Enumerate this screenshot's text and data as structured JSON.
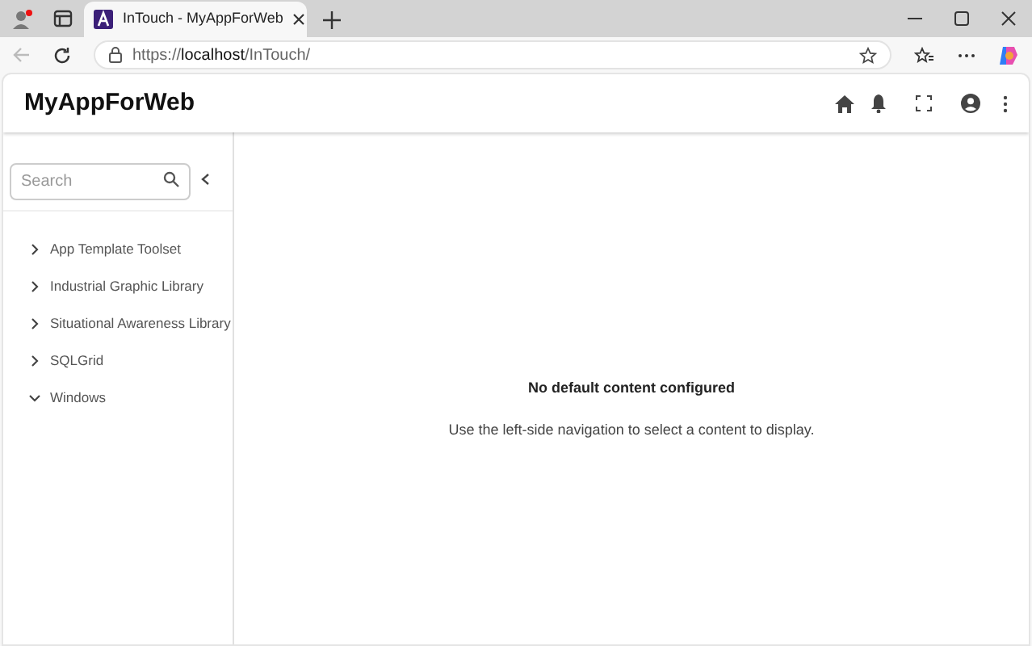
{
  "browser": {
    "tab": {
      "title": "InTouch - MyAppForWeb",
      "selected": true
    },
    "address": {
      "scheme": "https://",
      "host": "localhost",
      "path": "/InTouch/"
    }
  },
  "app": {
    "title": "MyAppForWeb"
  },
  "sidebar": {
    "search": {
      "placeholder": "Search"
    },
    "items": [
      {
        "label": "App Template Toolset",
        "expanded": false
      },
      {
        "label": "Industrial Graphic Library",
        "expanded": false
      },
      {
        "label": "Situational Awareness Library",
        "expanded": false
      },
      {
        "label": "SQLGrid",
        "expanded": false
      },
      {
        "label": "Windows",
        "expanded": true
      }
    ]
  },
  "content": {
    "heading": "No default content configured",
    "message": "Use the left-side navigation to select a content to display."
  }
}
